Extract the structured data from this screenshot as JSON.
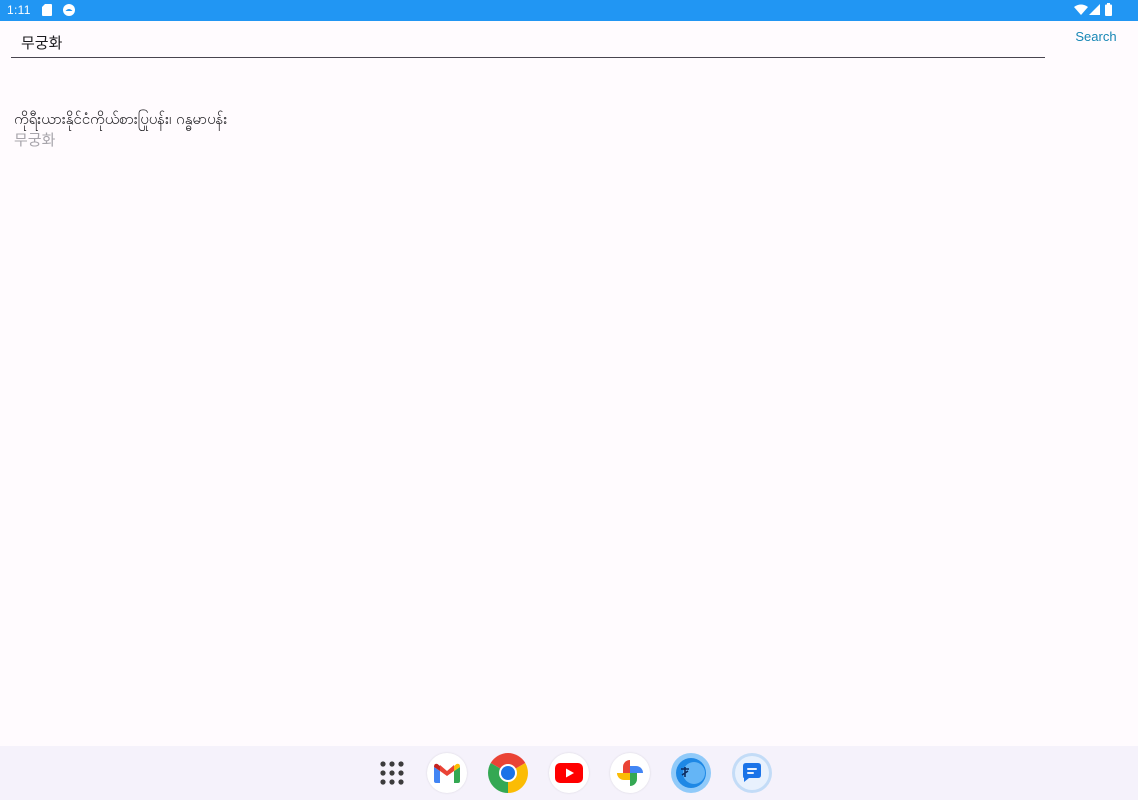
{
  "status_bar": {
    "time": "1:11",
    "icons": [
      "sd-card-icon",
      "app-notification-icon",
      "wifi-icon",
      "signal-icon",
      "battery-icon"
    ]
  },
  "search": {
    "query": "무궁화",
    "button_label": "Search"
  },
  "results": [
    {
      "translation": "ကိုရီးယားနိုင်ငံကိုယ်စားပြုပန်း၊ ဂန္ဓမာပန်း",
      "term": "무궁화"
    }
  ],
  "dock": {
    "apps": [
      "app-drawer-icon",
      "gmail-icon",
      "chrome-icon",
      "youtube-icon",
      "photos-icon",
      "dictionary-app-icon",
      "messages-icon"
    ]
  },
  "colors": {
    "status_bar": "#2196f3",
    "accent": "#1787b5",
    "background": "#fffbfe",
    "nav_bar": "#f5f2fb",
    "secondary_text": "#a7a4ab"
  }
}
